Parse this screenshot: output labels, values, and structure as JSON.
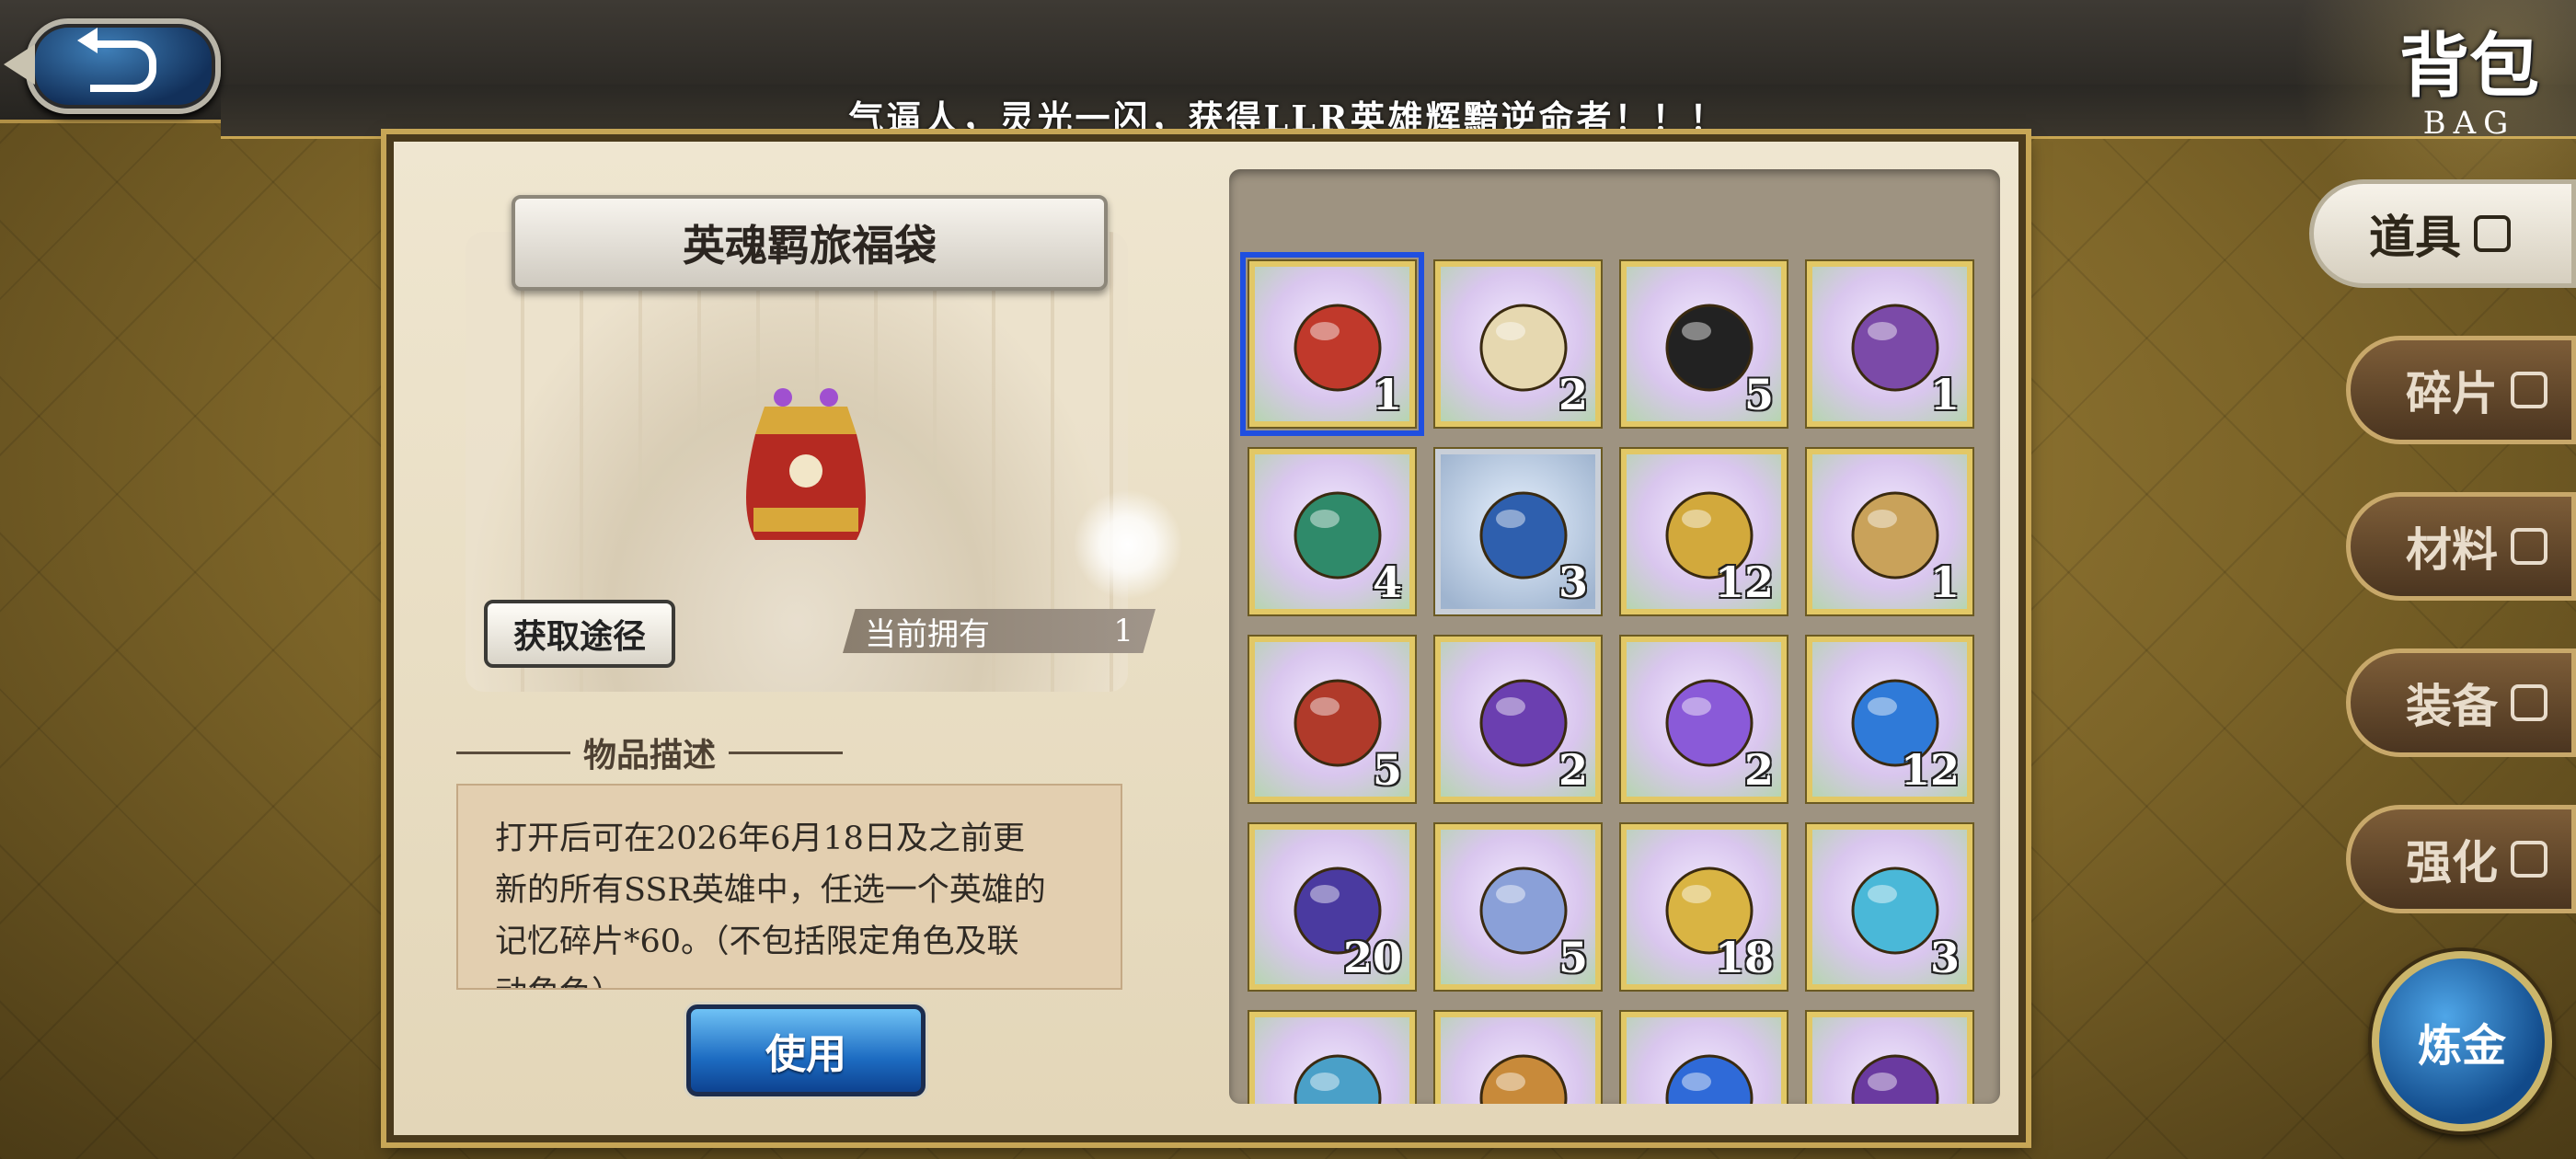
{
  "header": {
    "marquee": "气逼人，灵光一闪，获得LLR英雄辉黯逆命者！！！",
    "page_title_cn": "背包",
    "page_title_en": "BAG"
  },
  "detail": {
    "item_name": "英魂羁旅福袋",
    "source_button": "获取途径",
    "owned_label": "当前拥有",
    "owned_count": "1",
    "desc_heading": "物品描述",
    "desc_line1": "打开后可在2026年6月18日及之前更",
    "desc_line2": "新的所有SSR英雄中，任选一个英雄的",
    "desc_line3": "记忆碎片*60。（不包括限定角色及联",
    "desc_line4": "动角色）",
    "use_button": "使用"
  },
  "items": [
    {
      "icon": "lucky-bag-icon",
      "count": "1",
      "color": "#c0392b"
    },
    {
      "icon": "treasure-chest-icon",
      "count": "2",
      "color": "#e6d8b0"
    },
    {
      "icon": "mystery-scroll-icon",
      "count": "5",
      "color": "#222222"
    },
    {
      "icon": "purple-flower-crest-icon",
      "count": "1",
      "color": "#7b4aa8"
    },
    {
      "icon": "green-pouch-icon",
      "count": "4",
      "color": "#2f8a6a"
    },
    {
      "icon": "blue-pouch-icon",
      "count": "3",
      "color": "#2e5fae"
    },
    {
      "icon": "gold-card-icon",
      "count": "12",
      "color": "#d2a93c"
    },
    {
      "icon": "hourglass-icon",
      "count": "1",
      "color": "#c9a25a"
    },
    {
      "icon": "red-card-icon",
      "count": "5",
      "color": "#b03a2a"
    },
    {
      "icon": "purple-card-icon",
      "count": "2",
      "color": "#6b3fb0"
    },
    {
      "icon": "purple-crystal-icon",
      "count": "2",
      "color": "#8a5ad8"
    },
    {
      "icon": "blue-potion-icon",
      "count": "12",
      "color": "#2f7ad8"
    },
    {
      "icon": "paint-jar-icon",
      "count": "20",
      "color": "#4a3aa0"
    },
    {
      "icon": "mascot-figure-icon",
      "count": "5",
      "color": "#8aa0d8"
    },
    {
      "icon": "gold-wheel-icon",
      "count": "18",
      "color": "#d9b443"
    },
    {
      "icon": "rune-stone-icon",
      "count": "3",
      "color": "#4ab8d8"
    },
    {
      "icon": "small-potion-icon",
      "count": "",
      "color": "#4aa0c8"
    },
    {
      "icon": "bread-icon",
      "count": "",
      "color": "#c88a3a"
    },
    {
      "icon": "blue-orb-icon",
      "count": "",
      "color": "#2f6ad8"
    },
    {
      "icon": "purple-jar-icon",
      "count": "",
      "color": "#6a3aa0"
    }
  ],
  "tabs": [
    {
      "label": "道具",
      "icon": "flask-icon",
      "active": true
    },
    {
      "label": "碎片",
      "icon": "shard-icon",
      "active": false
    },
    {
      "label": "材料",
      "icon": "gear-flower-icon",
      "active": false
    },
    {
      "label": "装备",
      "icon": "shield-icon",
      "active": false
    },
    {
      "label": "强化",
      "icon": "upgrade-icon",
      "active": false
    }
  ],
  "alchemy_button": "炼金"
}
